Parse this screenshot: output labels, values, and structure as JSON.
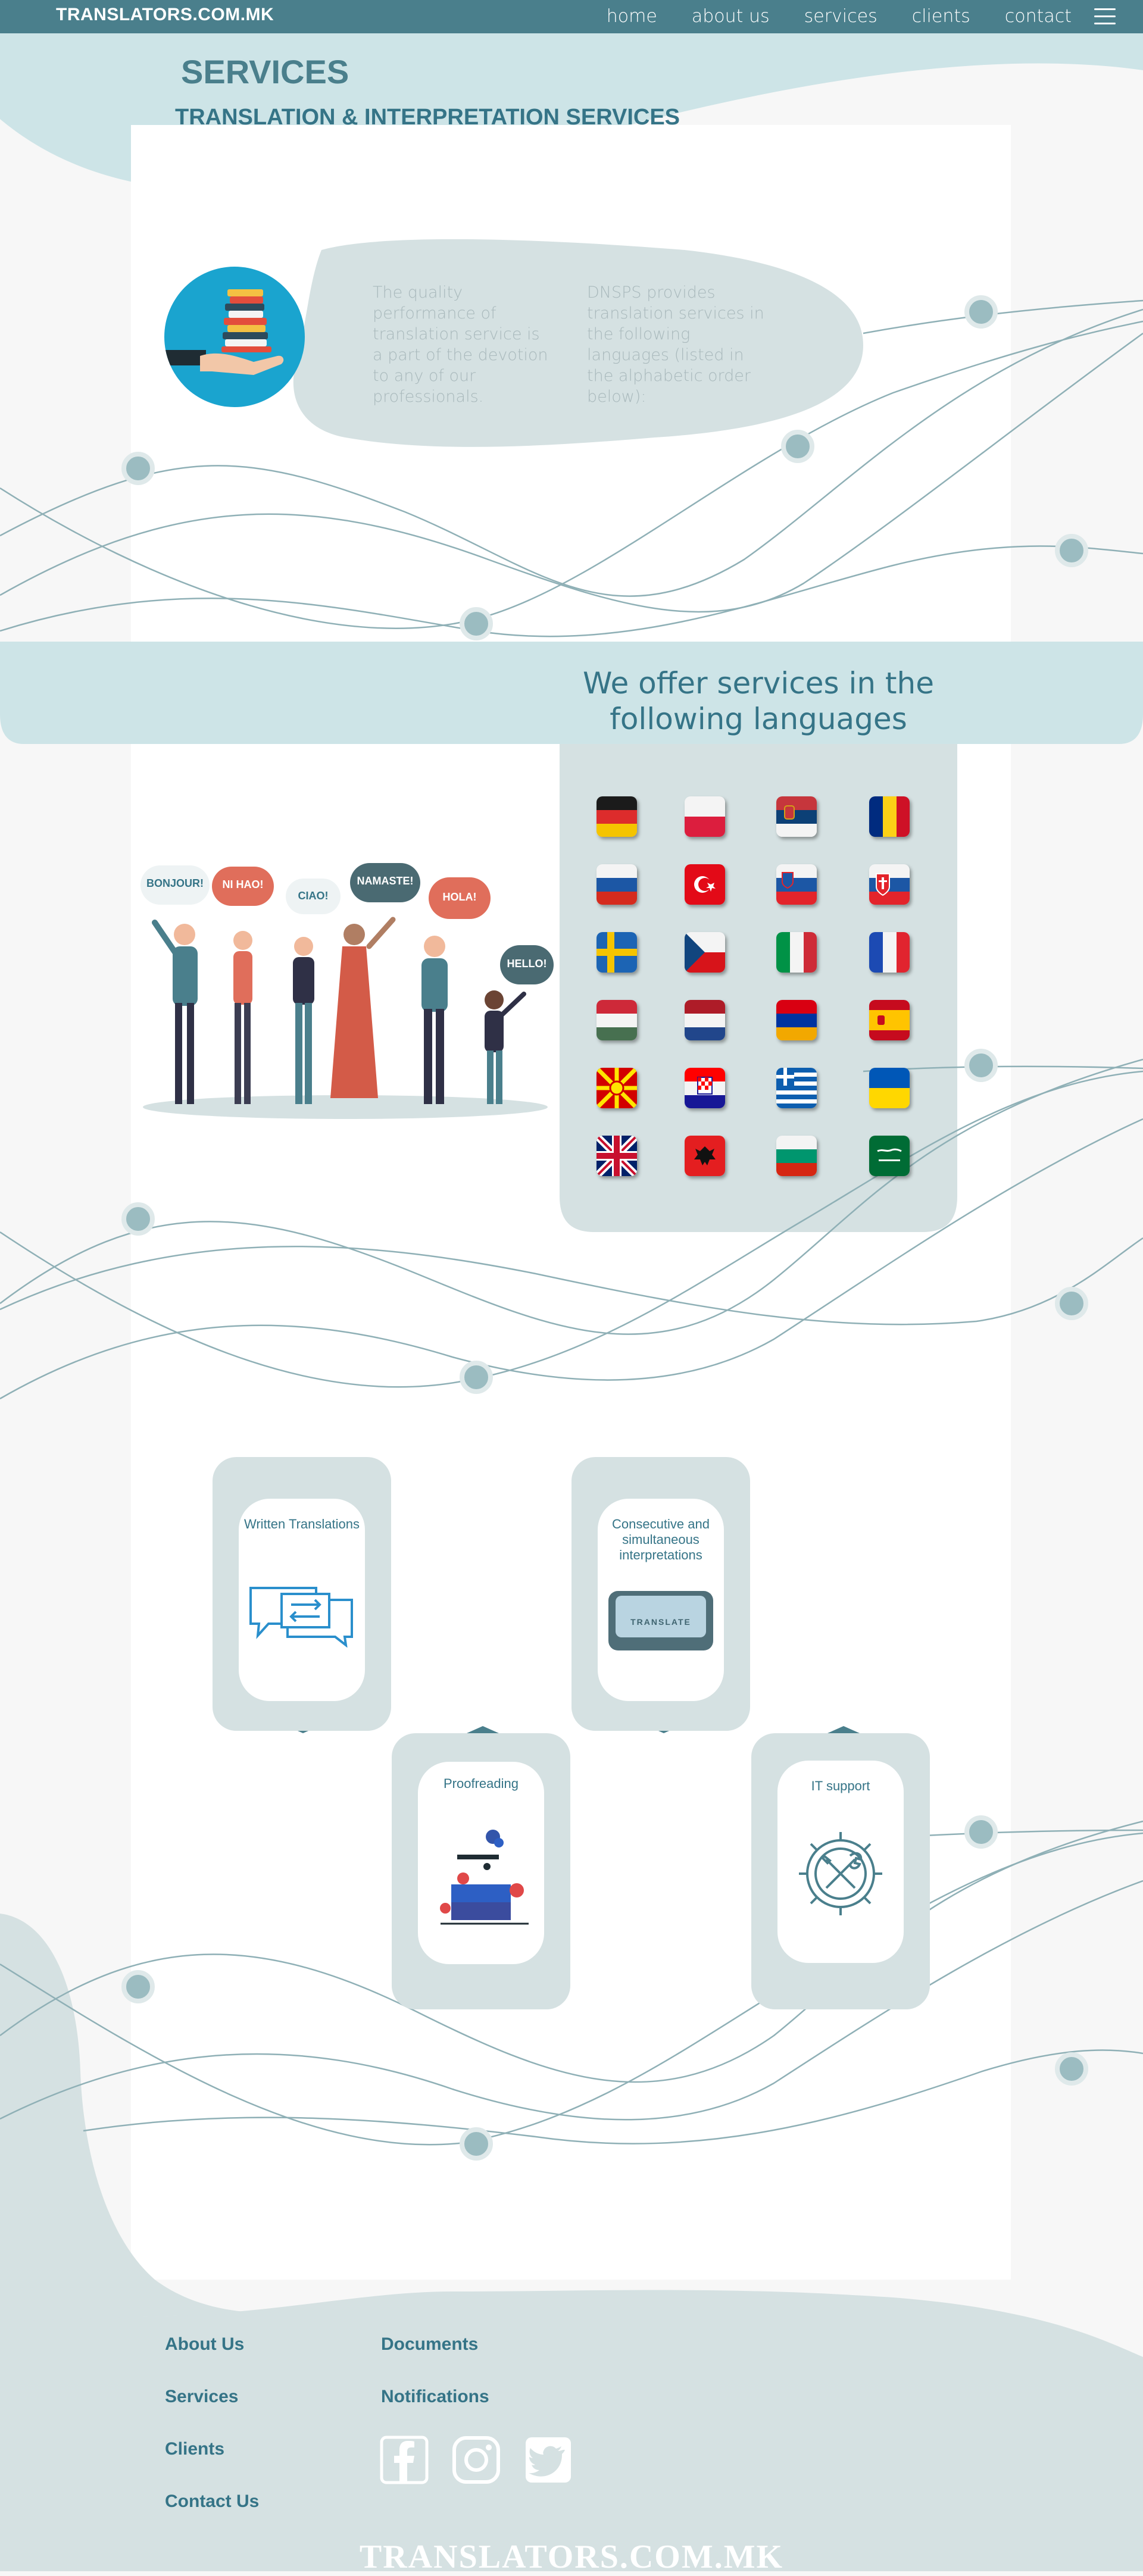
{
  "nav": {
    "brand": "TRANSLATORS.COM.MK",
    "links": [
      "home",
      "about us",
      "services",
      "clients",
      "contact"
    ]
  },
  "header": {
    "title": "SERVICES",
    "subtitle": "TRANSLATION & INTERPRETATION SERVICES"
  },
  "intro": {
    "left_text": "The quality performance of translation service is a part of the devotion to any of our professionals.",
    "right_text": "DNSPS provides translation services in the following languages (listed in the alphabetic order below):"
  },
  "languages": {
    "title": "We offer services in the following languages",
    "bubbles": [
      "BONJOUR!",
      "NI HAO!",
      "CIAO!",
      "NAMASTE!",
      "HOLA!",
      "HELLO!"
    ],
    "flags": [
      "germany-flag",
      "poland-flag",
      "serbia-flag",
      "romania-flag",
      "russia-flag",
      "turkey-flag",
      "slovenia-flag",
      "slovakia-flag",
      "sweden-flag",
      "czech-flag",
      "italy-flag",
      "france-flag",
      "hungary-flag",
      "netherlands-flag",
      "armenia-flag",
      "spain-flag",
      "north-macedonia-flag",
      "croatia-flag",
      "greece-flag",
      "ukraine-flag",
      "uk-flag",
      "albania-flag",
      "bulgaria-flag",
      "saudi-arabia-flag"
    ]
  },
  "services": {
    "written": "Written Translations",
    "interpretation": "Consecutive and simultaneous interpretations",
    "translate_key": "TRANSLATE",
    "proofreading": "Proofreading",
    "it_support": "IT support"
  },
  "footer": {
    "links": [
      "About Us",
      "Services",
      "Clients",
      "Contact Us",
      "Documents",
      "Notifications"
    ],
    "social": [
      "facebook-icon",
      "instagram-icon",
      "twitter-icon"
    ],
    "brand": "TRANSLATORS.COM.MK"
  },
  "colors": {
    "primary": "#4a7f8c",
    "light": "#d5e1e2",
    "light_blue": "#cde4e7",
    "title": "#357487"
  }
}
